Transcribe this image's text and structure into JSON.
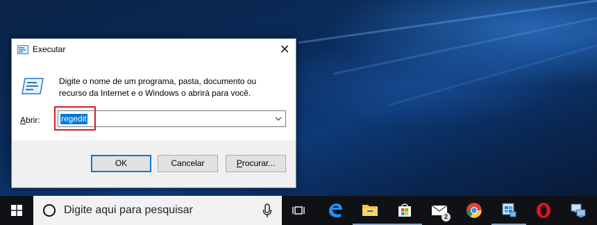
{
  "dialog": {
    "title": "Executar",
    "close_glyph": "✕",
    "description": "Digite o nome de um programa, pasta, documento ou recurso da Internet e o Windows o abrirá para você.",
    "open_label_accel": "A",
    "open_label_rest": "brir:",
    "input_value": "regedit",
    "buttons": {
      "ok": "OK",
      "cancel": "Cancelar",
      "browse_accel": "P",
      "browse_rest": "rocurar..."
    }
  },
  "taskbar": {
    "search_placeholder": "Digite aqui para pesquisar",
    "mail_badge": "2",
    "icons": [
      "windows-logo-icon",
      "search-icon",
      "microphone-icon",
      "task-view-icon",
      "edge-icon",
      "file-explorer-icon",
      "store-icon",
      "mail-icon",
      "chrome-icon",
      "regedit-icon",
      "opera-icon",
      "network-computer-icon"
    ]
  },
  "colors": {
    "accent": "#0078d7",
    "highlight_border": "#d01f1f",
    "taskbar": "#0f1114"
  }
}
